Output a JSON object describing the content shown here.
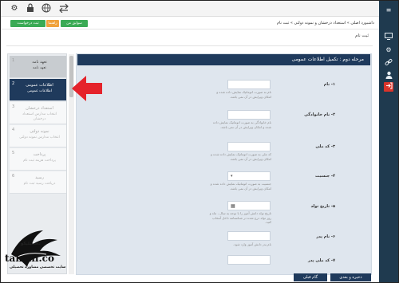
{
  "topbar": {
    "icons": [
      "settings-icon",
      "lock-icon",
      "globe-icon",
      "swap-icon"
    ]
  },
  "actions": {
    "btn_green_label": "ثبت درخواست",
    "btn_orange_label": "راهنما",
    "btn_green2_label": "سوابق من"
  },
  "breadcrumb": "داشبورد اصلی » استعداد درخشان و نمونه دولتی » ثبت نام",
  "page_title": "ثبت نام",
  "steps": [
    {
      "num": "1",
      "title": "تعهد نامه",
      "subtitle": "تعهد نامه",
      "state": "done"
    },
    {
      "num": "2",
      "title": "اطلاعات عمومی",
      "subtitle": "اطلاعات عمومی",
      "state": "active"
    },
    {
      "num": "3",
      "title": "استعداد درخشان",
      "subtitle": "انتخاب مدارس استعداد درخشان",
      "state": "todo"
    },
    {
      "num": "4",
      "title": "نمونه دولتی",
      "subtitle": "انتخاب مدارس نمونه دولتی",
      "state": "todo"
    },
    {
      "num": "5",
      "title": "پرداخت",
      "subtitle": "پرداخت هزینه ثبت نام",
      "state": "todo"
    },
    {
      "num": "6",
      "title": "رسید",
      "subtitle": "دریافت رسید ثبت نام",
      "state": "todo"
    }
  ],
  "panel": {
    "header": "مرحله دوم : تکمیل اطلاعات عمومی"
  },
  "fields": [
    {
      "label": "۱- نام",
      "help": "نام به صورت اتوماتیک نمایش داده شده و امکان ویرایش در آن نمی باشد."
    },
    {
      "label": "۲- نام خانوادگی",
      "help": "نام خانوادگی به صورت اتوماتیک نمایش داده شده و امکان ویرایش در آن نمی باشد."
    },
    {
      "label": "۳- کد ملی",
      "help": "کد ملی به صورت اتوماتیک نمایش داده شده و امکان ویرایش در آن نمی باشد."
    },
    {
      "label": "۴- جنسیت",
      "help": "جنسیت به صورت اتوماتیک نمایش داده شده و امکان ویرایش در آن نمی باشد."
    },
    {
      "label": "۵- تاریخ تولد",
      "help": "تاریخ تولد دانش آموز را با توجه به سال ، ماه و روز تولد درج شده در شناسنامه داخل آنتخاب کنید."
    },
    {
      "label": "۶- نام پدر",
      "help": "نام پدر دانش آموز وارد شود."
    },
    {
      "label": "۷- کد ملی پدر",
      "help": ""
    }
  ],
  "buttons": {
    "prev": "ذخیره و بعدی",
    "next": "گام قبلی"
  },
  "logo": {
    "latin": "tahsili.co",
    "persian": "تحصیلیکو",
    "subtitle": "سایت تخصصی مشاوره تحصیلی"
  },
  "rightbar_icons": [
    "monitor-icon",
    "gear-icon",
    "link-icon",
    "user-icon",
    "logout-icon"
  ],
  "colors": {
    "navy": "#1f3a5c",
    "sidebar": "#1f3a4f",
    "green": "#3aaa55",
    "orange": "#f0a23b",
    "arrow": "#e5232b"
  }
}
